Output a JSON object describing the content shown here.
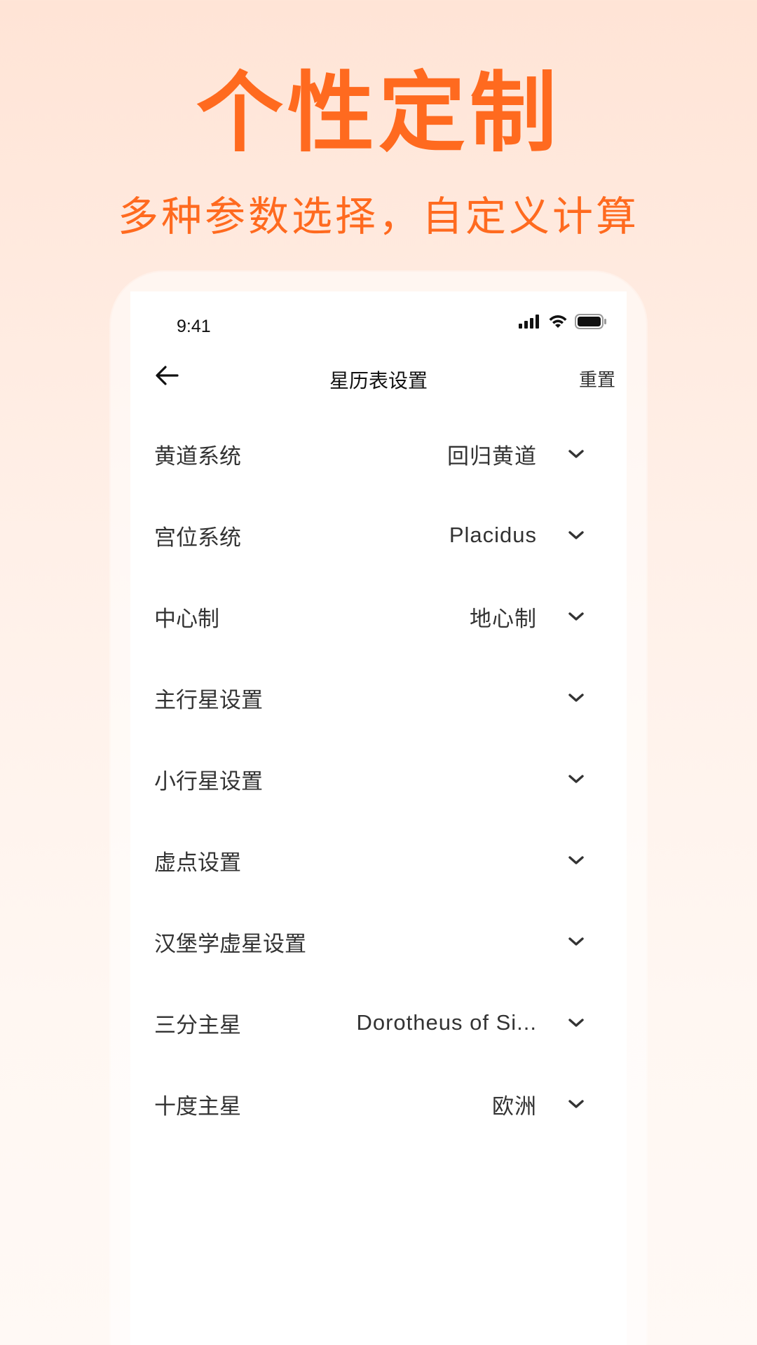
{
  "promo": {
    "title": "个性定制",
    "subtitle": "多种参数选择，自定义计算"
  },
  "status_bar": {
    "time": "9:41",
    "icons": [
      "signal-icon",
      "wifi-icon",
      "battery-icon"
    ]
  },
  "nav": {
    "back_icon": "arrow-left-icon",
    "title": "星历表设置",
    "reset_label": "重置"
  },
  "settings": [
    {
      "label": "黄道系统",
      "value": "回归黄道"
    },
    {
      "label": "宫位系统",
      "value": "Placidus"
    },
    {
      "label": "中心制",
      "value": "地心制"
    },
    {
      "label": "主行星设置",
      "value": ""
    },
    {
      "label": "小行星设置",
      "value": ""
    },
    {
      "label": "虚点设置",
      "value": ""
    },
    {
      "label": "汉堡学虚星设置",
      "value": ""
    },
    {
      "label": "三分主星",
      "value": "Dorotheus of Si..."
    },
    {
      "label": "十度主星",
      "value": "欧洲"
    }
  ],
  "colors": {
    "accent": "#ff6a1f",
    "text": "#333333"
  }
}
